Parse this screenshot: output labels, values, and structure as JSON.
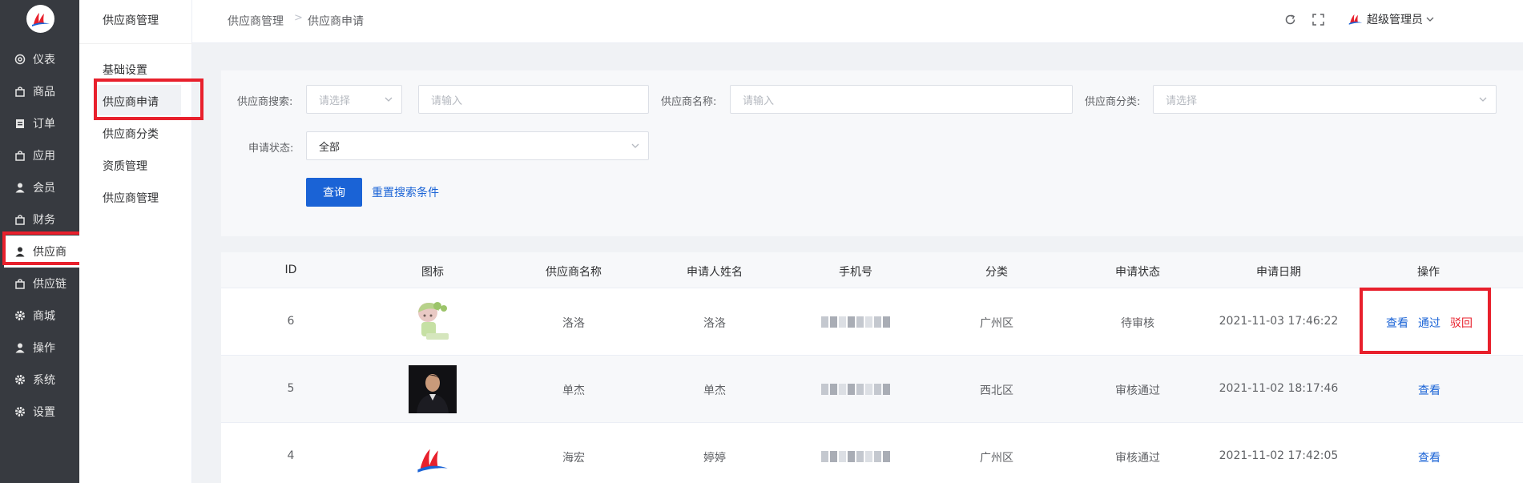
{
  "nav": {
    "items": [
      {
        "label": "仪表",
        "icon": "gauge-icon"
      },
      {
        "label": "商品",
        "icon": "bag-icon"
      },
      {
        "label": "订单",
        "icon": "clipboard-icon"
      },
      {
        "label": "应用",
        "icon": "bag-icon"
      },
      {
        "label": "会员",
        "icon": "user-icon"
      },
      {
        "label": "财务",
        "icon": "bag-icon"
      },
      {
        "label": "供应商",
        "icon": "user-icon"
      },
      {
        "label": "供应链",
        "icon": "bag-icon"
      },
      {
        "label": "商城",
        "icon": "gear-icon"
      },
      {
        "label": "操作",
        "icon": "user-icon"
      },
      {
        "label": "系统",
        "icon": "gear-icon"
      },
      {
        "label": "设置",
        "icon": "gear-icon"
      }
    ],
    "active_label": "供应商"
  },
  "submenu": {
    "title": "供应商管理",
    "items": [
      "基础设置",
      "供应商申请",
      "供应商分类",
      "资质管理",
      "供应商管理"
    ],
    "active_label": "供应商申请"
  },
  "breadcrumb": {
    "parent": "供应商管理",
    "separator": ">",
    "current": "供应商申请"
  },
  "user": {
    "name": "超级管理员"
  },
  "search": {
    "supplier_search_label": "供应商搜索:",
    "supplier_search_select_placeholder": "请选择",
    "supplier_search_input_placeholder": "请输入",
    "supplier_name_label": "供应商名称:",
    "supplier_name_placeholder": "请输入",
    "supplier_category_label": "供应商分类:",
    "supplier_category_placeholder": "请选择",
    "status_label": "申请状态:",
    "status_value": "全部",
    "query_button": "查询",
    "reset_link": "重置搜索条件"
  },
  "table": {
    "headers": [
      "ID",
      "图标",
      "供应商名称",
      "申请人姓名",
      "手机号",
      "分类",
      "申请状态",
      "申请日期",
      "操作"
    ],
    "rows": [
      {
        "id": "6",
        "name": "洛洛",
        "applicant": "洛洛",
        "category": "广州区",
        "status": "待审核",
        "date": "2021-11-03 17:46:22",
        "actions": [
          "查看",
          "通过",
          "驳回"
        ]
      },
      {
        "id": "5",
        "name": "单杰",
        "applicant": "单杰",
        "category": "西北区",
        "status": "审核通过",
        "date": "2021-11-02 18:17:46",
        "actions": [
          "查看"
        ]
      },
      {
        "id": "4",
        "name": "海宏",
        "applicant": "婷婷",
        "category": "广州区",
        "status": "审核通过",
        "date": "2021-11-02 17:42:05",
        "actions": [
          "查看"
        ]
      }
    ]
  },
  "colors": {
    "primary": "#1a63d6",
    "danger": "#e8202c",
    "nav_bg": "#373a40",
    "highlight": "#e8202c"
  }
}
